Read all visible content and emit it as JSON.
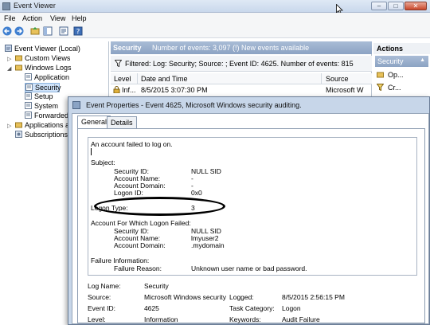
{
  "window": {
    "title": "Event Viewer",
    "min": "–",
    "max": "□",
    "close": "✕"
  },
  "menu": [
    "File",
    "Action",
    "View",
    "Help"
  ],
  "tree": {
    "root": "Event Viewer (Local)",
    "custom_views": "Custom Views",
    "windows_logs": "Windows Logs",
    "application": "Application",
    "security": "Security",
    "setup": "Setup",
    "system": "System",
    "forwarded": "Forwarded",
    "apps_services": "Applications a",
    "subscriptions": "Subscriptions"
  },
  "middle": {
    "log_name": "Security",
    "event_count": "Number of events: 3,097 (!) New events available",
    "filter_text": "Filtered: Log: Security; Source: ; Event ID: 4625. Number of events: 815",
    "columns": [
      "Level",
      "Date and Time",
      "Source"
    ],
    "row": {
      "level": "Inf...",
      "datetime": "8/5/2015 3:07:30 PM",
      "source": "Microsoft W"
    }
  },
  "actions": {
    "header": "Actions",
    "section": "Security",
    "items": [
      "Op...",
      "Cr..."
    ]
  },
  "dialog": {
    "title": "Event Properties - Event 4625, Microsoft Windows security auditing.",
    "tabs": [
      "General",
      "Details"
    ],
    "message": {
      "intro": "An account failed to log on.",
      "subject": "Subject:",
      "subject_fields": [
        {
          "label": "Security ID:",
          "value": "NULL SID"
        },
        {
          "label": "Account Name:",
          "value": "-"
        },
        {
          "label": "Account Domain:",
          "value": "-"
        },
        {
          "label": "Logon ID:",
          "value": "0x0"
        }
      ],
      "logon_type_label": "Logon Type:",
      "logon_type_value": "3",
      "failed_heading": "Account For Which Logon Failed:",
      "failed_fields": [
        {
          "label": "Security ID:",
          "value": "NULL SID"
        },
        {
          "label": "Account Name:",
          "value": "lmyuser2"
        },
        {
          "label": "Account Domain:",
          "value": ".mydomain"
        }
      ],
      "failure_heading": "Failure Information:",
      "failure_reason_label": "Failure Reason:",
      "failure_reason_value": "Unknown user name or bad password."
    },
    "fields": {
      "log_name_label": "Log Name:",
      "log_name_value": "Security",
      "source_label": "Source:",
      "source_value": "Microsoft Windows security",
      "logged_label": "Logged:",
      "logged_value": "8/5/2015 2:56:15 PM",
      "event_id_label": "Event ID:",
      "event_id_value": "4625",
      "task_category_label": "Task Category:",
      "task_category_value": "Logon",
      "level_label": "Level:",
      "level_value": "Information",
      "keywords_label": "Keywords:",
      "keywords_value": "Audit Failure"
    }
  }
}
